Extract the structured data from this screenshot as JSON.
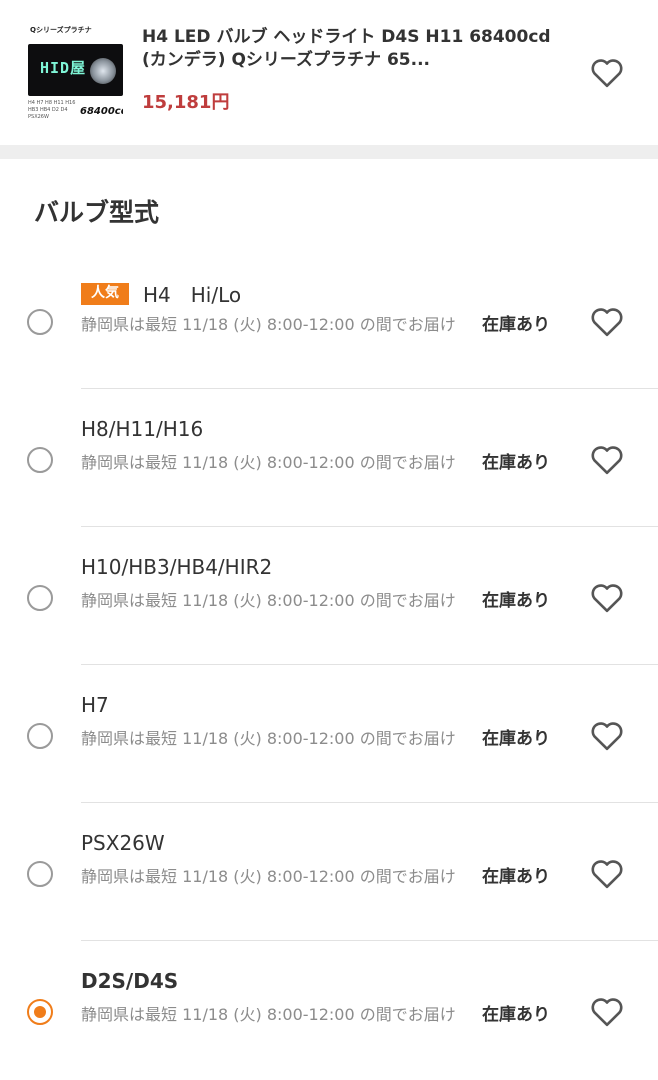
{
  "product": {
    "title": "H4 LED バルブ ヘッドライト D4S H11 68400cd (カンデラ) Qシリーズプラチナ 65...",
    "price": "15,181円",
    "thumb": {
      "brand": "Qシリーズプラチナ",
      "logo": "HID屋",
      "spec": "H4 H7 H8 H11 H16 HB3 HB4 D2 D4 PSX26W",
      "lumen": "68400cd"
    },
    "favorite_icon": "heart-outline-icon"
  },
  "section": {
    "title": "バルブ型式"
  },
  "variants": [
    {
      "badge": "人気",
      "name": "H4　Hi/Lo",
      "delivery": "静岡県は最短 11/18 (火) 8:00-12:00 の間でお届け",
      "stock": "在庫あり",
      "selected": false
    },
    {
      "badge": "",
      "name": "H8/H11/H16",
      "delivery": "静岡県は最短 11/18 (火) 8:00-12:00 の間でお届け",
      "stock": "在庫あり",
      "selected": false
    },
    {
      "badge": "",
      "name": "H10/HB3/HB4/HIR2",
      "delivery": "静岡県は最短 11/18 (火) 8:00-12:00 の間でお届け",
      "stock": "在庫あり",
      "selected": false
    },
    {
      "badge": "",
      "name": "H7",
      "delivery": "静岡県は最短 11/18 (火) 8:00-12:00 の間でお届け",
      "stock": "在庫あり",
      "selected": false
    },
    {
      "badge": "",
      "name": "PSX26W",
      "delivery": "静岡県は最短 11/18 (火) 8:00-12:00 の間でお届け",
      "stock": "在庫あり",
      "selected": false
    },
    {
      "badge": "",
      "name": "D2S/D4S",
      "delivery": "静岡県は最短 11/18 (火) 8:00-12:00 の間でお届け",
      "stock": "在庫あり",
      "selected": true
    }
  ],
  "colors": {
    "accent": "#f07d1a",
    "price": "#bf3d3d",
    "muted_text": "#8c8c8c"
  }
}
